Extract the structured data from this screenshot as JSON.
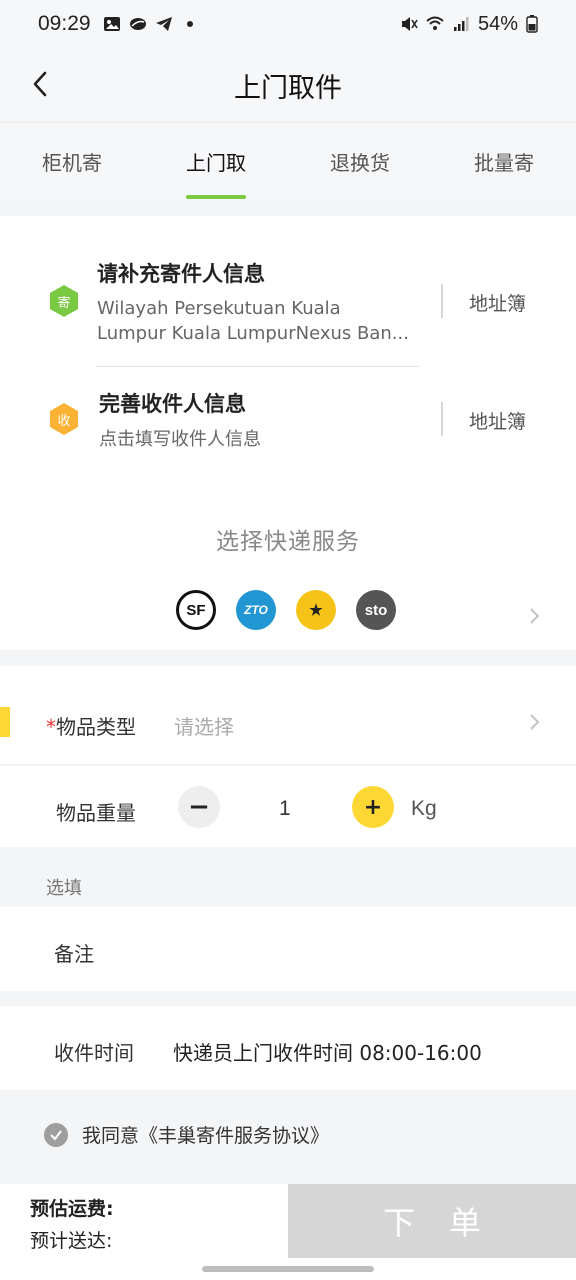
{
  "status_bar": {
    "time": "09:29",
    "battery_pct": "54%",
    "left_icons": [
      "gallery-icon",
      "leaf-icon",
      "telegram-icon",
      "dot-icon"
    ],
    "right_icons": [
      "mute-icon",
      "wifi-icon",
      "signal-icon",
      "battery-icon"
    ]
  },
  "nav": {
    "title": "上门取件",
    "back_icon": "back-arrow-icon"
  },
  "tabs": [
    {
      "label": "柜机寄",
      "active": false
    },
    {
      "label": "上门取",
      "active": true
    },
    {
      "label": "退换货",
      "active": false
    },
    {
      "label": "批量寄",
      "active": false
    }
  ],
  "sender": {
    "badge": "寄",
    "title": "请补充寄件人信息",
    "address_line1": "Wilayah Persekutuan Kuala",
    "address_line2": "Lumpur Kuala LumpurNexus Ban...",
    "book_label": "地址簿",
    "badge_color": "#7ac943"
  },
  "receiver": {
    "badge": "收",
    "title": "完善收件人信息",
    "subtitle": "点击填写收件人信息",
    "book_label": "地址簿",
    "badge_color": "#f9b233"
  },
  "service": {
    "title": "选择快递服务",
    "logos": [
      {
        "name": "SF",
        "text": "SF",
        "color": "#111111"
      },
      {
        "name": "ZTO",
        "text": "ZTO",
        "color": "#2196d3"
      },
      {
        "name": "Yunda",
        "text": "★",
        "color": "#f6c319"
      },
      {
        "name": "STO",
        "text": "sto",
        "color": "#555555"
      }
    ]
  },
  "item_type": {
    "required_mark": "*",
    "label": "物品类型",
    "placeholder": "请选择"
  },
  "weight": {
    "label": "物品重量",
    "value": "1",
    "unit": "Kg",
    "minus": "−",
    "plus": "+"
  },
  "optional": {
    "section_label": "选填",
    "remark_label": "备注"
  },
  "pickup_time": {
    "label": "收件时间",
    "value": "快递员上门收件时间 08:00-16:00"
  },
  "agreement": {
    "text": "我同意《丰巢寄件服务协议》"
  },
  "footer": {
    "estimate_label": "预估运费:",
    "eta_label": "预计送达:",
    "order_button": "下单"
  }
}
